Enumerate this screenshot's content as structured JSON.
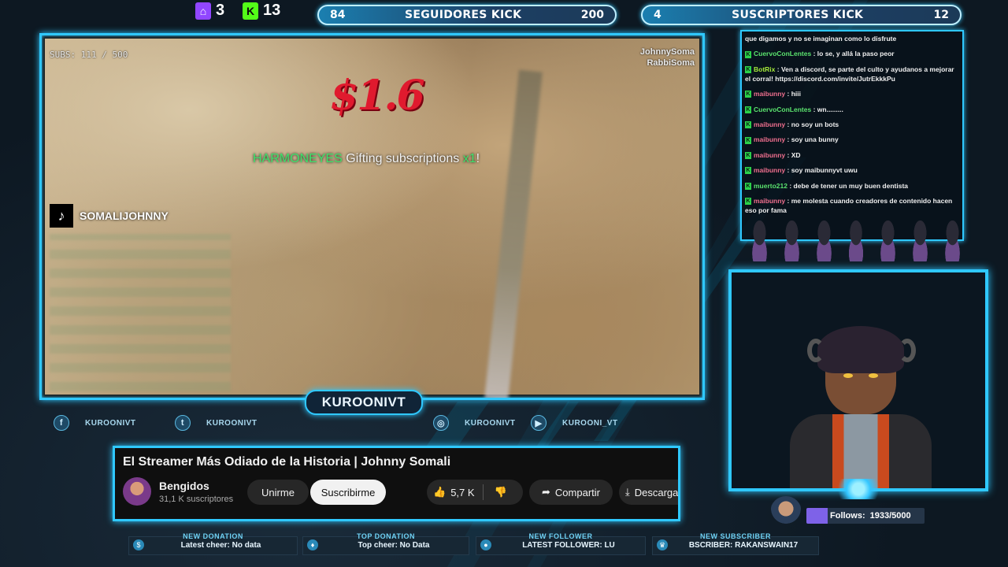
{
  "top": {
    "twitch_count": "3",
    "kick_count": "13",
    "followers_goal": {
      "current": "84",
      "title": "SEGUIDORES KICK",
      "target": "200",
      "progress": 0.42
    },
    "subs_goal": {
      "current": "4",
      "title": "SUSCRIPTORES KICK",
      "target": "12",
      "progress": 0.33
    }
  },
  "video": {
    "subs_counter": "SUBS: 111 / 500",
    "amount": "$1.6",
    "gift_user": "HARMONEYES",
    "gift_text": " Gifting subscriptions ",
    "gift_count": "x1",
    "gift_bang": "!",
    "tiktok_name": "SOMALIJOHNNY",
    "overlay_line1": "JohnnySoma",
    "overlay_line2": "RabbiSoma"
  },
  "channel_tag": "KUROONIVT",
  "socials": [
    {
      "icon": "facebook-icon",
      "label": "KUROONIVT"
    },
    {
      "icon": "twitter-icon",
      "label": "KUROONIVT"
    },
    {
      "icon": "instagram-icon",
      "label": "KUROONIVT"
    },
    {
      "icon": "youtube-icon",
      "label": "KUROONI_VT"
    }
  ],
  "youtube": {
    "title": "El Streamer Más Odiado de la Historia | Johnny Somali",
    "channel": "Bengidos",
    "subscribers": "31,1 K suscriptores",
    "join": "Unirme",
    "subscribe": "Suscribirme",
    "likes": "5,7 K",
    "share": "Compartir",
    "download": "Descargar"
  },
  "alerts": [
    {
      "label": "NEW DONATION",
      "text": "Latest cheer: No data"
    },
    {
      "label": "TOP DONATION",
      "text": "Top cheer: No Data"
    },
    {
      "label": "NEW FOLLOWER",
      "text": "LATEST FOLLOWER: LU"
    },
    {
      "label": "NEW SUBSCRIBER",
      "text": "BSCRIBER: RAKANSWAIN17"
    }
  ],
  "chat": [
    {
      "user": "",
      "color": "",
      "text": "que digamos y no se imaginan como lo disfrute"
    },
    {
      "user": "CuervoConLentes",
      "color": "green",
      "text": " : lo se, y allá la paso peor"
    },
    {
      "user": "BotRix",
      "color": "lime",
      "text": " : Ven a discord, se parte del culto y ayudanos a mejorar el corral! https://discord.com/invite/JutrEkkkPu"
    },
    {
      "user": "maibunny",
      "color": "pink",
      "text": " : hiii"
    },
    {
      "user": "CuervoConLentes",
      "color": "green",
      "text": " : wn........."
    },
    {
      "user": "maibunny",
      "color": "pink",
      "text": " : no soy un bots"
    },
    {
      "user": "maibunny",
      "color": "pink",
      "text": " : soy una bunny"
    },
    {
      "user": "maibunny",
      "color": "pink",
      "text": " : XD"
    },
    {
      "user": "maibunny",
      "color": "pink",
      "text": " : soy maibunnyvt uwu"
    },
    {
      "user": "muerto212",
      "color": "green",
      "text": " : debe de tener un muy buen dentista"
    },
    {
      "user": "maibunny",
      "color": "pink",
      "text": " : me molesta cuando creadores de contenido hacen eso por fama"
    }
  ],
  "follows": {
    "label": "Follows:",
    "value": "1933/5000",
    "progress": 0.39
  }
}
